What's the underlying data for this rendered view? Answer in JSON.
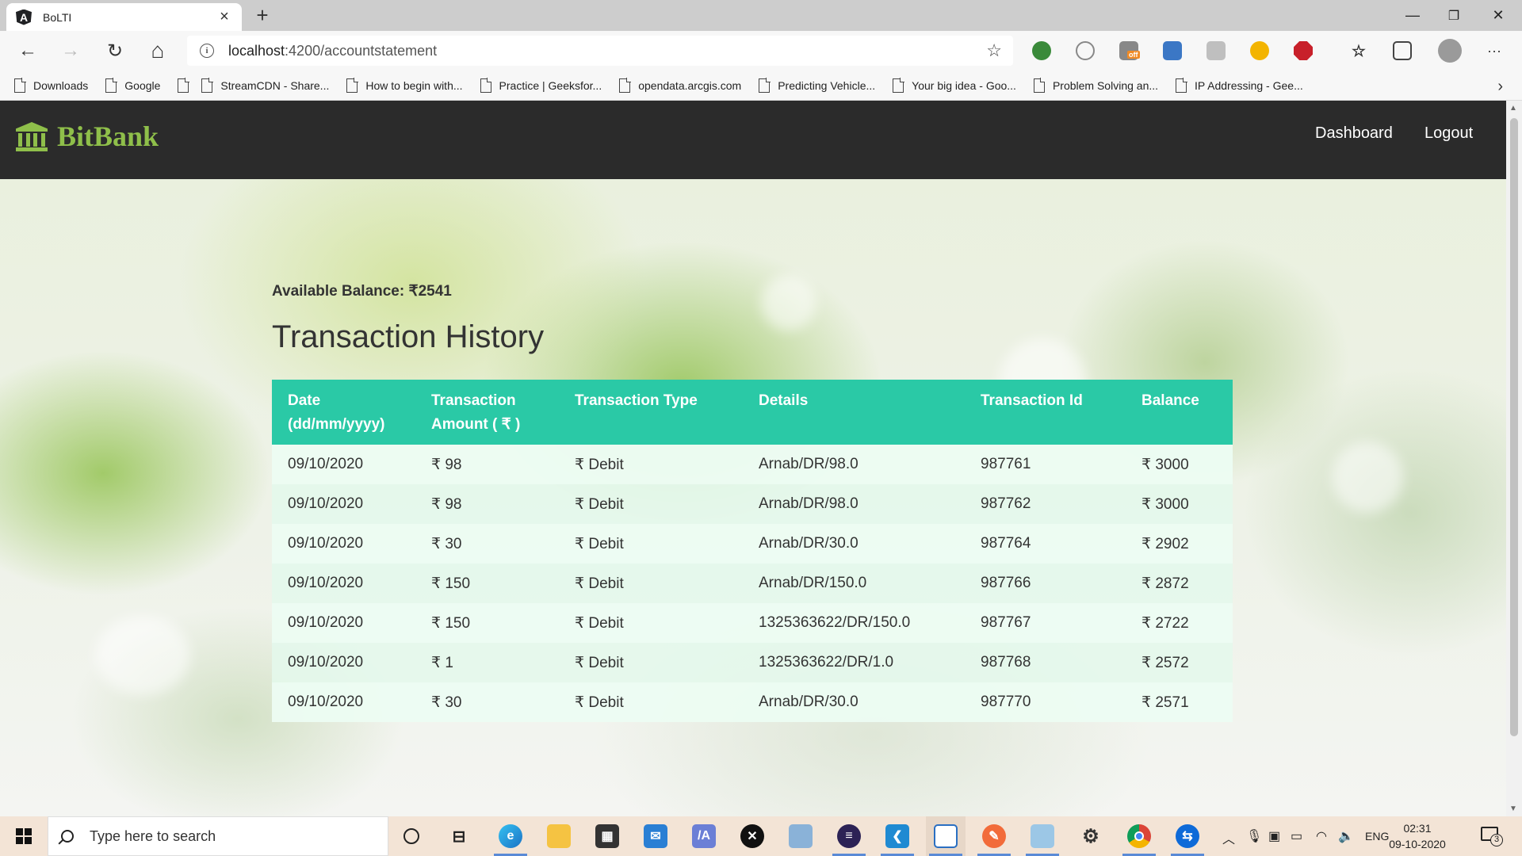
{
  "browser": {
    "tab_title": "BoLTI",
    "tab_close": "×",
    "new_tab": "+",
    "url_host": "localhost",
    "url_path": ":4200/accountstatement",
    "window": {
      "minimize": "—",
      "maximize": "❐",
      "close": "✕"
    },
    "nav": {
      "back": "←",
      "forward": "→",
      "reload": "↻",
      "home": "⌂"
    },
    "star": "☆",
    "menu": "···",
    "bookmarks": [
      "Downloads",
      "Google",
      "",
      "StreamCDN - Share...",
      "How to begin with...",
      "Practice | Geeksfor...",
      "opendata.arcgis.com",
      "Predicting Vehicle...",
      "Your big idea - Goo...",
      "Problem Solving an...",
      "IP Addressing - Gee..."
    ],
    "bookmarks_more": "›",
    "extension_badge": "off"
  },
  "app": {
    "brand": "BitBank",
    "nav": {
      "dashboard": "Dashboard",
      "logout": "Logout"
    },
    "balance_label": "Available Balance: ₹2541",
    "title": "Transaction History",
    "table": {
      "headers": {
        "date_line1": "Date",
        "date_line2": "(dd/mm/yyyy)",
        "amount_line1": "Transaction",
        "amount_line2": "Amount ( ₹ )",
        "type": "Transaction Type",
        "details": "Details",
        "id": "Transaction Id",
        "balance": "Balance"
      },
      "rows": [
        {
          "date": "09/10/2020",
          "amount": "₹ 98",
          "type": "₹ Debit",
          "details": "Arnab/DR/98.0",
          "id": "987761",
          "balance": "₹ 3000"
        },
        {
          "date": "09/10/2020",
          "amount": "₹ 98",
          "type": "₹ Debit",
          "details": "Arnab/DR/98.0",
          "id": "987762",
          "balance": "₹ 3000"
        },
        {
          "date": "09/10/2020",
          "amount": "₹ 30",
          "type": "₹ Debit",
          "details": "Arnab/DR/30.0",
          "id": "987764",
          "balance": "₹ 2902"
        },
        {
          "date": "09/10/2020",
          "amount": "₹ 150",
          "type": "₹ Debit",
          "details": "Arnab/DR/150.0",
          "id": "987766",
          "balance": "₹ 2872"
        },
        {
          "date": "09/10/2020",
          "amount": "₹ 150",
          "type": "₹ Debit",
          "details": "1325363622/DR/150.0",
          "id": "987767",
          "balance": "₹ 2722"
        },
        {
          "date": "09/10/2020",
          "amount": "₹ 1",
          "type": "₹ Debit",
          "details": "1325363622/DR/1.0",
          "id": "987768",
          "balance": "₹ 2572"
        },
        {
          "date": "09/10/2020",
          "amount": "₹ 30",
          "type": "₹ Debit",
          "details": "Arnab/DR/30.0",
          "id": "987770",
          "balance": "₹ 2571"
        }
      ]
    }
  },
  "taskbar": {
    "search_placeholder": "Type here to search",
    "language": "ENG",
    "time": "02:31",
    "date": "09-10-2020",
    "notification_count": "3"
  },
  "colors": {
    "nav_bg": "#2b2b2b",
    "brand": "#8fbf4a",
    "table_header": "#2ac9a6",
    "row_bg": "#ecfcf3"
  }
}
